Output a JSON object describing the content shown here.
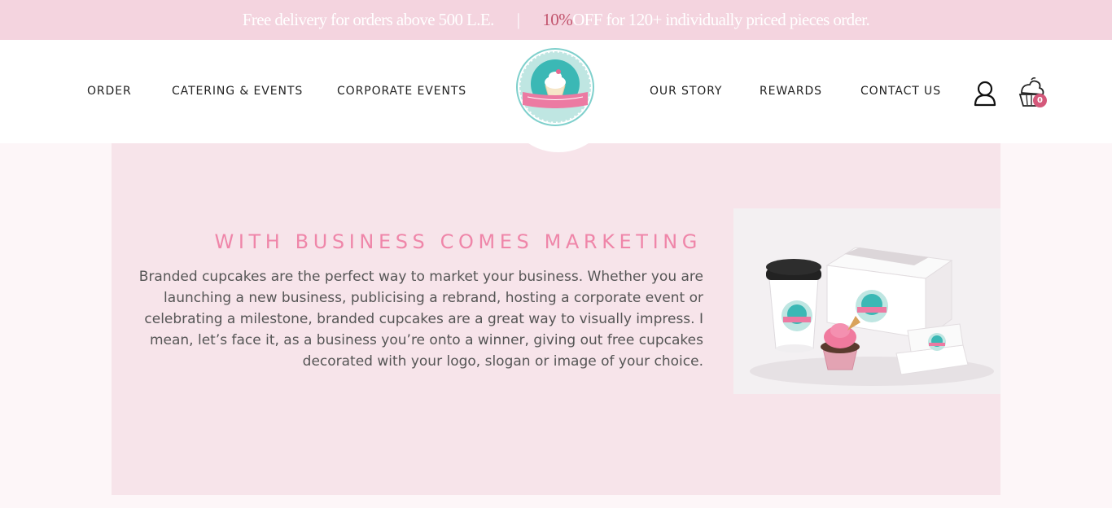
{
  "promo": {
    "delivery_text": "Free delivery for orders above 500 L.E.",
    "separator": "|",
    "discount_highlight": "10%",
    "discount_text": " OFF for 120+ individually priced pieces order."
  },
  "nav": {
    "left": [
      {
        "label": "ORDER"
      },
      {
        "label": "CATERING & EVENTS"
      },
      {
        "label": "CORPORATE EVENTS"
      }
    ],
    "right": [
      {
        "label": "OUR STORY"
      },
      {
        "label": "REWARDS"
      },
      {
        "label": "CONTACT US"
      }
    ],
    "cart_count": "0"
  },
  "section": {
    "title": "WITH BUSINESS COMES MARKETING",
    "body": "Branded cupcakes are the perfect way to market your business. Whether you are launching a new business, publicising a rebrand, hosting a corporate event or celebrating a milestone, branded cupcakes are a great way to visually impress. I mean, let’s face it, as a business you’re onto a winner, giving out free cupcakes decorated with your logo, slogan or image of your choice."
  },
  "colors": {
    "promo_bg": "#f4d4df",
    "accent_pink": "#ef86a9",
    "highlight": "#c2546d",
    "panel_bg": "#f7e4ea",
    "badge": "#d4587a",
    "teal": "#3bb8b5"
  },
  "icons": {
    "logo": "cupcake-logo",
    "user": "user-icon",
    "cart": "cupcake-cart-icon"
  }
}
